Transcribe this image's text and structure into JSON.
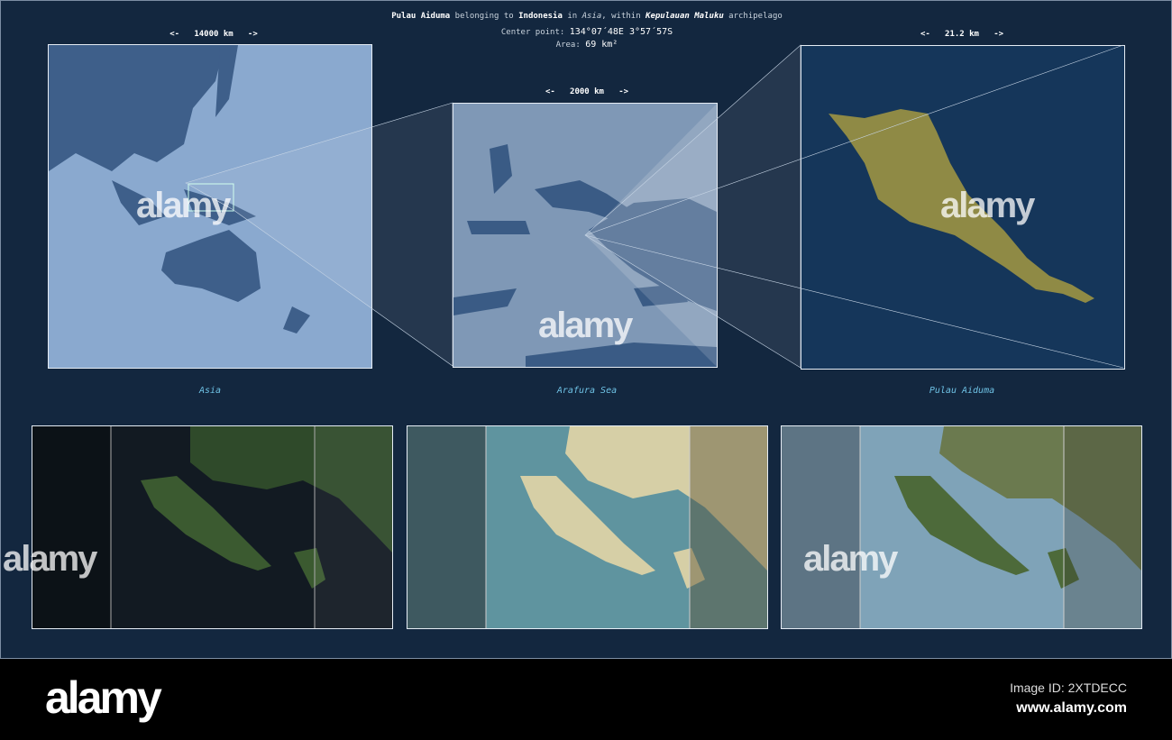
{
  "header": {
    "name": "Pulau Aiduma",
    "t1": "belonging to",
    "country": "Indonesia",
    "t2": "in",
    "continent": "Asia",
    "t3": ", within",
    "archipelago": "Kepulauan Maluku",
    "t4": "archipelago",
    "center_label": "Center point:",
    "center_value": "134°07´48E  3°57´57S",
    "area_label": "Area:",
    "area_value": "69 km²"
  },
  "scales": {
    "asia": "<-   14000 km   ->",
    "region": "<-   2000 km   ->",
    "island": "<-   21.2 km   ->"
  },
  "labels": {
    "asia": "Asia",
    "region": "Arafura Sea",
    "island": "Pulau Aiduma"
  },
  "watermark": "alamy",
  "footer": {
    "logo": "alamy",
    "image_id": "Image ID: 2XTDECC",
    "site": "www.alamy.com"
  },
  "colors": {
    "background": "#13273f",
    "ocean_light": "#8aa9cf",
    "land_dark": "#3e5f8a",
    "island_fill": "#8f8a45",
    "label": "#6fc3e6"
  }
}
